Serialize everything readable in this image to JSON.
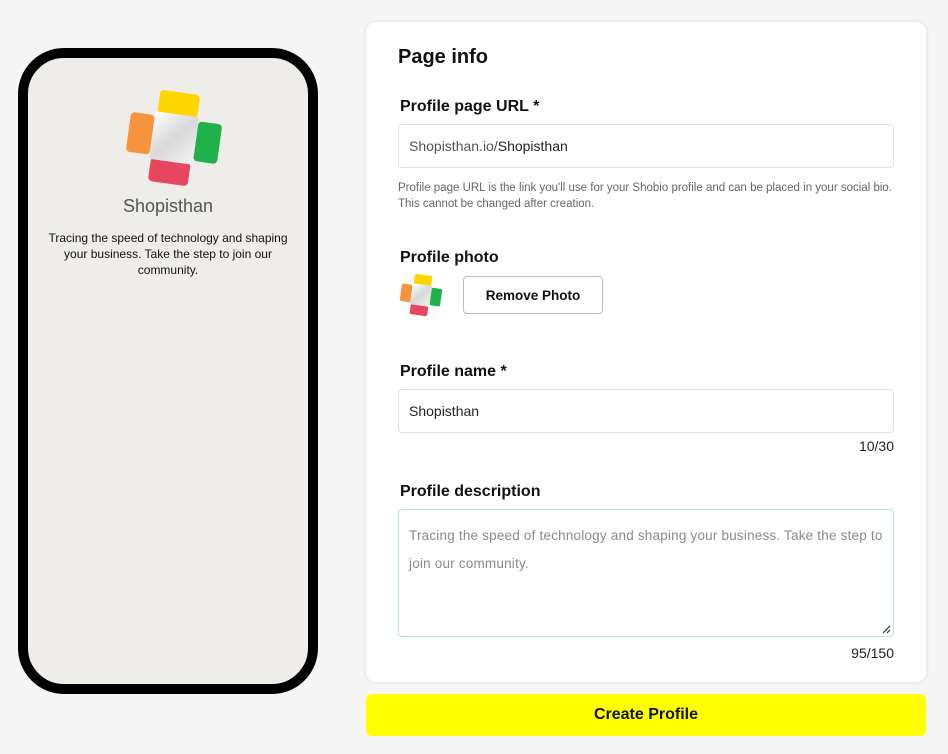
{
  "preview": {
    "name": "Shopisthan",
    "description": "Tracing the speed of technology and shaping your business. Take the step to join our community."
  },
  "card": {
    "title": "Page info",
    "url_label": "Profile page URL *",
    "url_prefix": "Shopisthan.io/",
    "url_value": "Shopisthan",
    "url_hint": "Profile page URL is the link you'll use for your Shobio profile and can be placed in your social bio. This cannot be changed after creation.",
    "photo_label": "Profile photo",
    "remove_photo_label": "Remove Photo",
    "name_label": "Profile name *",
    "name_value": "Shopisthan",
    "name_counter": "10/30",
    "description_label": "Profile description",
    "description_value": "Tracing the speed of technology and shaping your business. Take the step to join our community.",
    "description_counter": "95/150"
  },
  "actions": {
    "create_label": "Create Profile"
  },
  "colors": {
    "accent": "#ffff00",
    "logo_yellow": "#ffd600",
    "logo_green": "#1fb24a",
    "logo_red": "#e8465e",
    "logo_orange": "#f7943e"
  },
  "icons": [
    "logo-icon",
    "resize-handle-icon"
  ]
}
